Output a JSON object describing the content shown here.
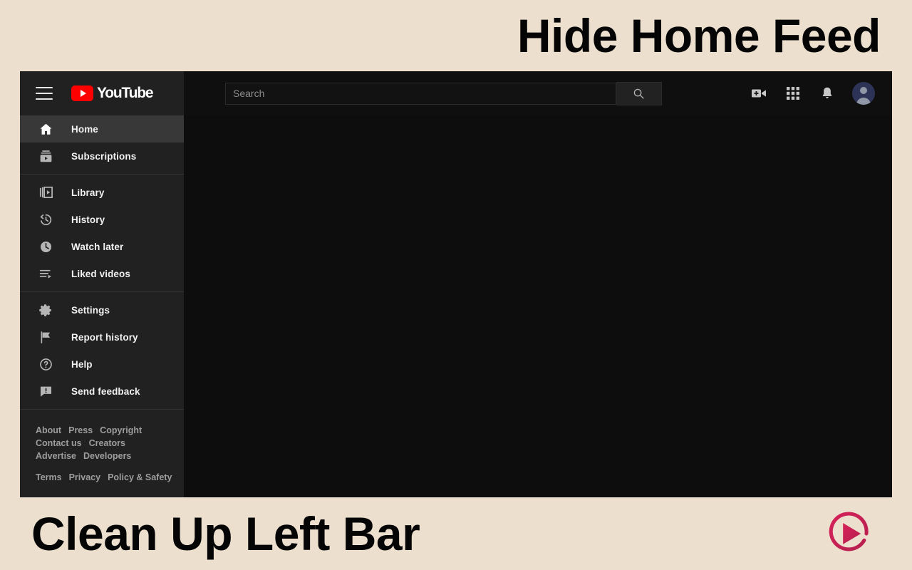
{
  "banners": {
    "top_headline": "Hide Home Feed",
    "bottom_headline": "Clean Up Left Bar",
    "brand_logo_icon": "play-circle-logo",
    "beige_bg": "#EDDFCE",
    "headline_color": "#050505",
    "logo_color": "#CE2458"
  },
  "header": {
    "menu_icon": "hamburger-menu-icon",
    "logo": {
      "icon": "youtube-play-icon",
      "wordmark": "YouTube",
      "red": "#FF0000"
    },
    "search": {
      "placeholder": "Search",
      "value": "",
      "button_icon": "search-icon"
    },
    "actions": [
      {
        "name": "create-video-icon",
        "label": "Create"
      },
      {
        "name": "apps-grid-icon",
        "label": "YouTube apps"
      },
      {
        "name": "notifications-bell-icon",
        "label": "Notifications"
      }
    ],
    "avatar_icon": "account-avatar"
  },
  "sidebar": {
    "active_item": "Home",
    "groups": [
      {
        "items": [
          {
            "label": "Home",
            "icon": "home-icon",
            "active": true
          },
          {
            "label": "Subscriptions",
            "icon": "subscriptions-icon",
            "active": false
          }
        ]
      },
      {
        "items": [
          {
            "label": "Library",
            "icon": "library-icon",
            "active": false
          },
          {
            "label": "History",
            "icon": "history-icon",
            "active": false
          },
          {
            "label": "Watch later",
            "icon": "watch-later-icon",
            "active": false
          },
          {
            "label": "Liked videos",
            "icon": "liked-videos-icon",
            "active": false
          }
        ]
      },
      {
        "items": [
          {
            "label": "Settings",
            "icon": "settings-gear-icon",
            "active": false
          },
          {
            "label": "Report history",
            "icon": "flag-icon",
            "active": false
          },
          {
            "label": "Help",
            "icon": "help-circle-icon",
            "active": false
          },
          {
            "label": "Send feedback",
            "icon": "feedback-icon",
            "active": false
          }
        ]
      }
    ],
    "footer": {
      "row1": [
        "About",
        "Press",
        "Copyright"
      ],
      "row2": [
        "Contact us",
        "Creators"
      ],
      "row3": [
        "Advertise",
        "Developers"
      ],
      "row4": [
        "Terms",
        "Privacy",
        "Policy & Safety"
      ]
    }
  }
}
